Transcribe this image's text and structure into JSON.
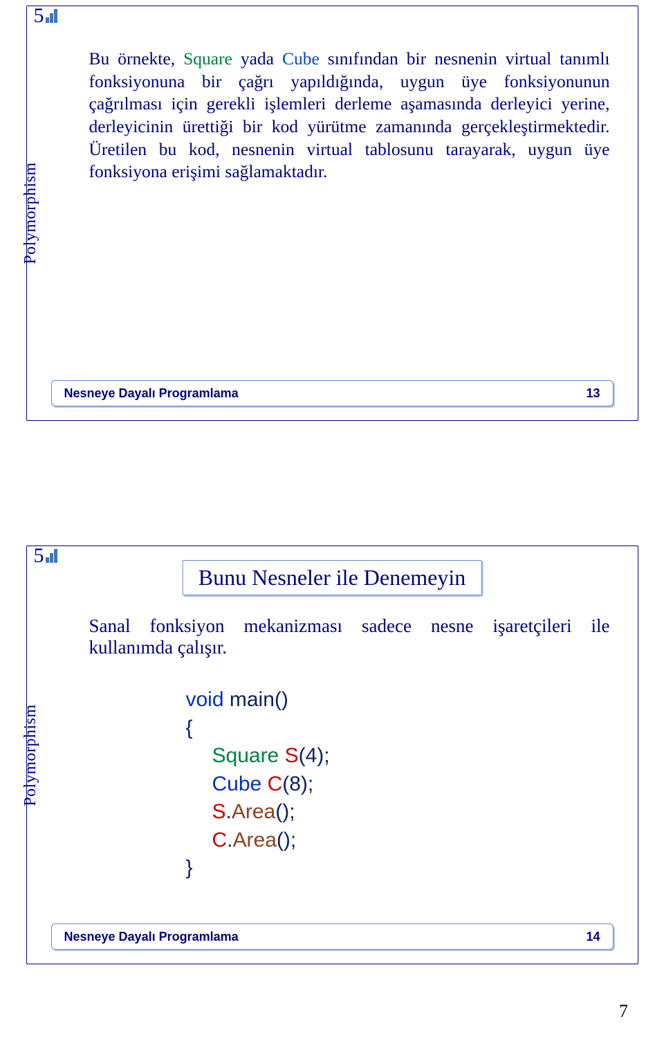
{
  "chapter_number": "5",
  "sidebar_label": "Polymorphism",
  "slide1": {
    "para_leadin": "Bu örnekte, ",
    "square": "Square",
    "yada": " yada ",
    "cube": "Cube",
    "rest": " sınıfından bir nesnenin virtual tanımlı fonksiyonuna bir çağrı yapıldığında, uygun üye fonksiyonunun çağrılması için gerekli işlemleri derleme aşamasında derleyici yerine, derleyicinin ürettiği bir kod yürütme zamanında gerçekleştirmektedir. Üretilen bu kod, nesnenin virtual tablosunu tarayarak, uygun üye fonksiyona erişimi sağlamaktadır."
  },
  "slide2": {
    "title": "Bunu Nesneler ile Denemeyin",
    "warn": "Sanal fonksiyon mekanizması sadece nesne işaretçileri ile kullanımda çalışır.",
    "code": {
      "l1a": "void",
      "l1b": " main()",
      "l2": "{",
      "l3a": "Square ",
      "l3b": "S",
      "l3c": "(4);",
      "l4a": "Cube ",
      "l4b": "C",
      "l4c": "(8);",
      "l5a": "S",
      "l5b": ".",
      "l5c": "Area",
      "l5d": "();",
      "l6a": "C",
      "l6b": ".",
      "l6c": "Area",
      "l6d": "();",
      "l7": "}"
    }
  },
  "footer": {
    "title": "Nesneye Dayalı Programlama",
    "p13": "13",
    "p14": "14"
  },
  "page_number": "7"
}
